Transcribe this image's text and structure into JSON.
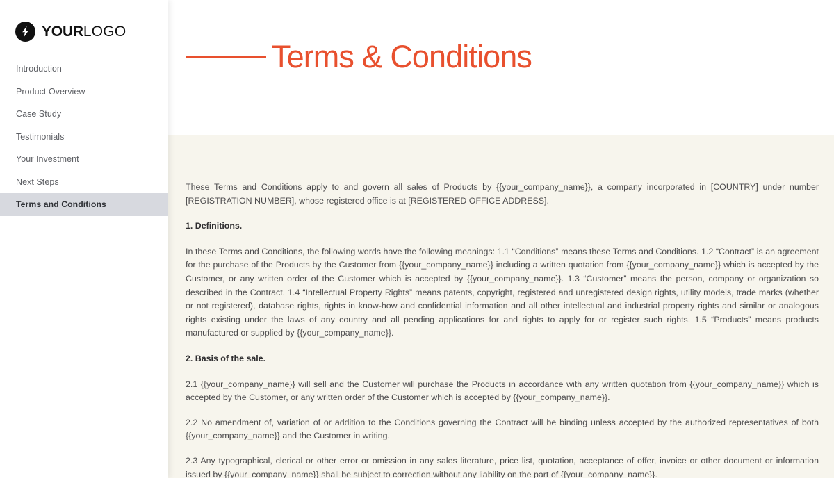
{
  "sidebar": {
    "logo": {
      "icon": "lightning-bolt-icon",
      "bold_part": "YOUR",
      "light_part": "LOGO"
    },
    "items": [
      {
        "label": "Introduction",
        "active": false
      },
      {
        "label": "Product Overview",
        "active": false
      },
      {
        "label": "Case Study",
        "active": false
      },
      {
        "label": "Testimonials",
        "active": false
      },
      {
        "label": "Your Investment",
        "active": false
      },
      {
        "label": "Next Steps",
        "active": false
      },
      {
        "label": "Terms and Conditions",
        "active": true
      }
    ]
  },
  "header": {
    "title": "Terms & Conditions",
    "accent_color": "#e8502e"
  },
  "document": {
    "background_color": "#f7f5ed",
    "blocks": [
      {
        "type": "paragraph",
        "text": "These Terms and Conditions apply to and govern all sales of Products by {{your_company_name}}, a company incorporated in [COUNTRY] under number [REGISTRATION NUMBER], whose registered office is at [REGISTERED OFFICE ADDRESS]."
      },
      {
        "type": "heading",
        "text": "1. Definitions."
      },
      {
        "type": "paragraph",
        "text": "In these Terms and Conditions, the following words have the following meanings:   1.1 “Conditions” means these Terms and Conditions. 1.2 “Contract” is an agreement for the purchase of the Products by the Customer from {{your_company_name}} including a written quotation from {{your_company_name}} which is accepted by the Customer, or any written order of the Customer which is accepted by {{your_company_name}}. 1.3 “Customer” means the person, company or organization so described in the Contract. 1.4 “Intellectual Property Rights” means patents, copyright, registered and unregistered design rights, utility models, trade marks (whether or not registered), database rights, rights in know-how and confidential information and all other intellectual and industrial property rights and similar or analogous rights existing under the laws of any country and all pending applications for and rights to apply for or register such rights. 1.5 “Products” means products manufactured or supplied by {{your_company_name}}."
      },
      {
        "type": "heading",
        "text": "2. Basis of the sale."
      },
      {
        "type": "paragraph",
        "text": "2.1 {{your_company_name}} will sell and the Customer will purchase the Products in accordance with any written quotation from {{your_company_name}} which is accepted by the Customer, or any written order of the Customer which is accepted by {{your_company_name}}."
      },
      {
        "type": "paragraph",
        "text": "2.2 No amendment of, variation of or addition to the Conditions governing the Contract will be binding unless accepted by the authorized representatives of both {{your_company_name}} and the Customer in writing."
      },
      {
        "type": "paragraph",
        "text": "2.3 Any typographical, clerical or other error or omission in any sales literature, price list, quotation, acceptance of offer, invoice or other document or information issued by {{your_company_name}} shall be subject to correction without any liability on the part of {{your_company_name}}."
      }
    ]
  }
}
